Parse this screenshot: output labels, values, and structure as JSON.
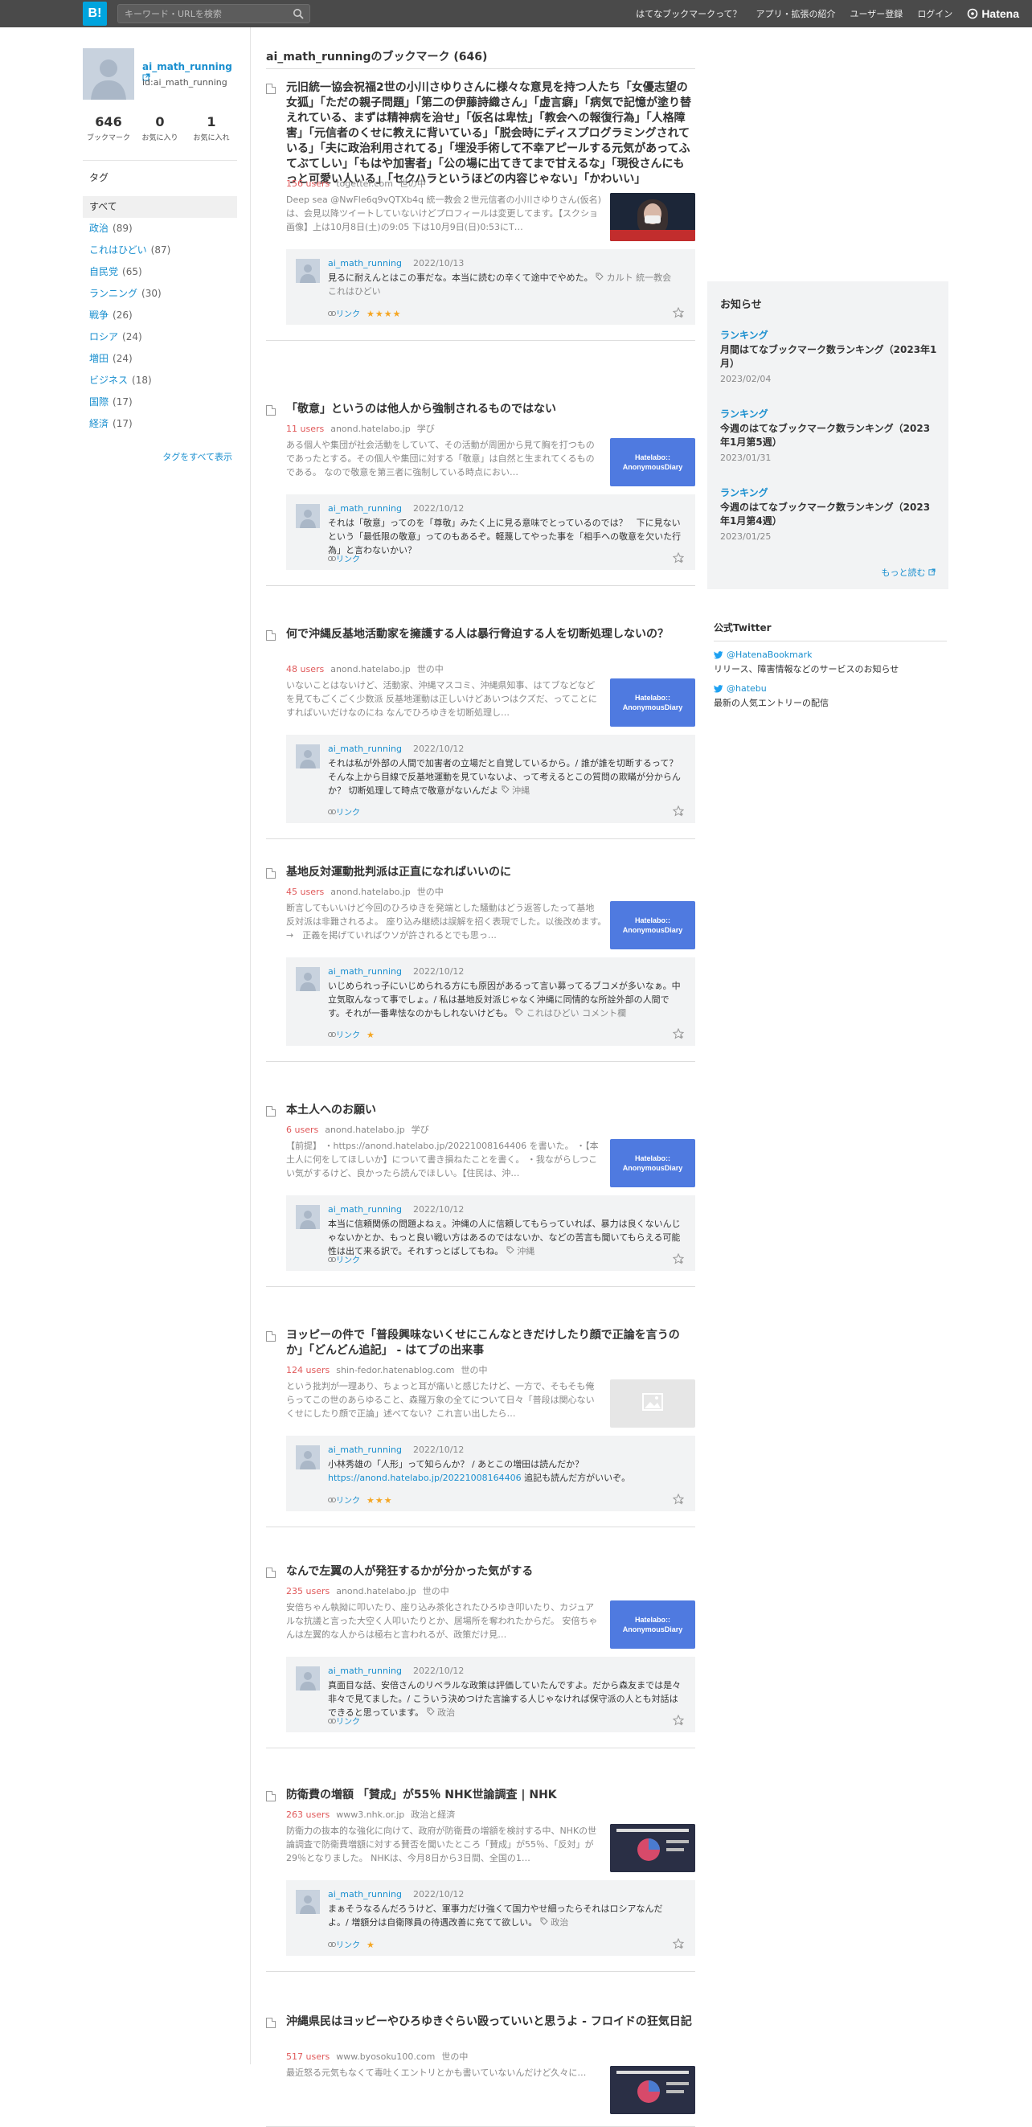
{
  "header": {
    "logo": "B!",
    "search_placeholder": "キーワード・URLを検索",
    "nav": [
      "はてなブックマークって？",
      "アプリ・拡張の紹介",
      "ユーザー登録",
      "ログイン"
    ],
    "brand": "Hatena",
    "bg_color": "#4a4a4a",
    "logo_color": "#00a4de"
  },
  "profile": {
    "name": "ai_math_running",
    "id": "id:ai_math_running",
    "stats": [
      {
        "num": "646",
        "label": "ブックマーク"
      },
      {
        "num": "0",
        "label": "お気に入り"
      },
      {
        "num": "1",
        "label": "お気に入れ"
      }
    ],
    "tag_heading": "タグ",
    "tags": [
      {
        "name": "すべて",
        "count": ""
      },
      {
        "name": "政治",
        "count": "(89)"
      },
      {
        "name": "これはひどい",
        "count": "(87)"
      },
      {
        "name": "自民党",
        "count": "(65)"
      },
      {
        "name": "ランニング",
        "count": "(30)"
      },
      {
        "name": "戦争",
        "count": "(26)"
      },
      {
        "name": "ロシア",
        "count": "(24)"
      },
      {
        "name": "増田",
        "count": "(24)"
      },
      {
        "name": "ビジネス",
        "count": "(18)"
      },
      {
        "name": "国際",
        "count": "(17)"
      },
      {
        "name": "経済",
        "count": "(17)"
      }
    ],
    "all_tags_link": "タグをすべて表示"
  },
  "main": {
    "title": "ai_math_runningのブックマーク (646)",
    "entries": [
      {
        "title": "元旧統一協会祝福2世の小川さゆりさんに様々な意見を持つ人たち「女優志望の女狐」「ただの親子問題」「第二の伊藤詩織さん」「虚言癖」「病気で記憶が塗り替えれている、まずは精神病を治せ」「仮名は卑怯」「教会への報復行為」「人格障害」「元信者のくせに教えに背いている」「脱会時にディスプログラミングされている」「夫に政治利用されてる」「埋没手術して不幸アピールする元気があってふてぶてしい」「もはや加害者」「公の場に出てきてまで甘えるな」「現役さんにもっと可愛い人いる」「セクハラというほどの内容じゃない」「かわいい」",
        "users": "156 users",
        "domain": "togetter.com",
        "category": "世の中",
        "desc": "Deep sea @NwFle6q9vQTXb4q 統一教会２世元信者の小川さゆりさん(仮名)は、会見以降ツイートしていないけどプロフィールは変更してます。【スクショ画像】上は10月8日(土)の9:05 下は10月9日(日)0:53にT…",
        "user": "ai_math_running",
        "date": "2022/10/13",
        "comment": "見るに耐えんとはこの事だな。本当に読むの辛くて途中でやめた。",
        "tags": "カルト 統一教会 これはひどい",
        "link": "リンク",
        "stars": "★★★★"
      },
      {
        "title": "「敬意」というのは他人から強制されるものではない",
        "users": "11 users",
        "domain": "anond.hatelabo.jp",
        "category": "学び",
        "desc": "ある個人や集団が社会活動をしていて、その活動が周囲から見て胸を打つものであったとする。その個人や集団に対する「敬意」は自然と生まれてくるものである。 なので敬意を第三者に強制している時点におい…",
        "user": "ai_math_running",
        "date": "2022/10/12",
        "comment": "それは「敬意」ってのを「尊敬」みたく上に見る意味でとっているのでは？　下に見ないという「最低限の敬意」ってのもあるぞ。軽蔑してやった事を「相手への敬意を欠いた行為」と言わないかい？",
        "tags": "",
        "link": "リンク",
        "stars": ""
      },
      {
        "title": "何で沖縄反基地活動家を擁護する人は暴行脅迫する人を切断処理しないの？",
        "users": "48 users",
        "domain": "anond.hatelabo.jp",
        "category": "世の中",
        "desc": "いないことはないけど、活動家、沖縄マスコミ、沖縄県知事、はてブなどなどを見てもごくごく少数派 反基地運動は正しいけどあいつはクズだ、ってことにすればいいだけなのにね なんでひろゆきを切断処理し…",
        "user": "ai_math_running",
        "date": "2022/10/12",
        "comment": "それは私が外部の人間で加害者の立場だと自覚しているから。/ 誰が誰を切断するって？ そんな上から目線で反基地運動を見ていないよ、って考えるとこの質問の欺瞞が分からんか？ 切断処理して時点で敬意がないんだよ",
        "tags": "沖縄",
        "link": "リンク",
        "stars": ""
      },
      {
        "title": "基地反対運動批判派は正直になればいいのに",
        "users": "45 users",
        "domain": "anond.hatelabo.jp",
        "category": "世の中",
        "desc": "断言してもいいけど今回のひろゆきを発端とした騒動はどう返答したって基地反対派は非難されるよ。 座り込み継続は誤解を招く表現でした。以後改めます。　→　正義を掲げていればウソが許されるとでも思っ…",
        "user": "ai_math_running",
        "date": "2022/10/12",
        "comment": "いじめられっ子にいじめられる方にも原因があるって言い募ってるブコメが多いなぁ。中立気取んなって事でしょ。/ 私は基地反対派じゃなく沖縄に同情的な所詮外部の人間です。それが一番卑怯なのかもしれないけども。",
        "tags": "これはひどい コメント欄",
        "link": "リンク",
        "stars": "★"
      },
      {
        "title": "本土人へのお願い",
        "users": "6 users",
        "domain": "anond.hatelabo.jp",
        "category": "学び",
        "desc": "【前提】 ・https://anond.hatelabo.jp/20221008164406 を書いた。 ・【本土人に何をしてほしいか】について書き損ねたことを書く。 ・我ながらしつこい気がするけど、良かったら読んでほしい。【住民は、沖…",
        "user": "ai_math_running",
        "date": "2022/10/12",
        "comment": "本当に信頼関係の問題よねぇ。沖縄の人に信頼してもらっていれば、暴力は良くないんじゃないかとか、もっと良い戦い方はあるのではないか、などの苦言も聞いてもらえる可能性は出て来る訳で。それすっとばしてもね。",
        "tags": "沖縄",
        "link": "リンク",
        "stars": ""
      },
      {
        "title": "ヨッピーの件で「普段興味ないくせにこんなときだけしたり顔で正論を言うのか」「どんどん追記」 - はてブの出来事",
        "users": "124 users",
        "domain": "shin-fedor.hatenablog.com",
        "category": "世の中",
        "desc": "という批判が一理あり、ちょっと耳が痛いと感じたけど、一方で、そもそも俺らってこの世のあらゆること、森羅万象の全てについて日々「普段は関心ないくせにしたり顔で正論」述べてない？これ言い出したら…",
        "user": "ai_math_running",
        "date": "2022/10/12",
        "comment": "小林秀雄の「人形」って知らんか？ / あとこの増田は読んだか？",
        "comment_link": "https://anond.hatelabo.jp/20221008164406",
        "comment_after": " 追記も読んだ方がいいぞ。",
        "tags": "",
        "link": "リンク",
        "stars": "★★★"
      },
      {
        "title": "なんで左翼の人が発狂するかが分かった気がする",
        "users": "235 users",
        "domain": "anond.hatelabo.jp",
        "category": "世の中",
        "desc": "安倍ちゃん執拗に叩いたり、座り込み茶化されたひろゆき叩いたり、カジュアルな抗議と言った大空く人叩いたりとか、居場所を奪われたからだ。 安倍ちゃんは左翼的な人からは極右と言われるが、政策だけ見…",
        "user": "ai_math_running",
        "date": "2022/10/12",
        "comment": "真面目な話、安倍さんのリベラルな政策は評価していたんですよ。だから森友までは是々非々で見てました。/ こういう決めつけた言論する人じゃなければ保守派の人とも対話はできると思っています。",
        "tags": "政治",
        "link": "リンク",
        "stars": ""
      },
      {
        "title": "防衛費の増額 「賛成」が55％ NHK世論調査 | NHK",
        "users": "263 users",
        "domain": "www3.nhk.or.jp",
        "category": "政治と経済",
        "desc": "防衛力の抜本的な強化に向けて、政府が防衛費の増額を検討する中、NHKの世論調査で防衛費増額に対する賛否を聞いたところ「賛成」が55％、「反対」が29％となりました。 NHKは、今月8日から3日間、全国の1…",
        "user": "ai_math_running",
        "date": "2022/10/12",
        "comment": "まぁそうなるんだろうけど、軍事力だけ強くて国力やせ細ったらそれはロシアなんだよ。/ 増額分は自衛隊員の待遇改善に充てて欲しい。",
        "tags": "政治",
        "link": "リンク",
        "stars": "★"
      },
      {
        "title": "沖縄県民はヨッピーやひろゆきぐらい殴っていいと思うよ - フロイドの狂気日記",
        "users": "517 users",
        "domain": "www.byosoku100.com",
        "category": "世の中",
        "desc": "最近怒る元気もなくて毒吐くエントリとかも書いていないんだけど久々に…"
      }
    ]
  },
  "notices": {
    "heading": "お知らせ",
    "items": [
      {
        "cat": "ランキング",
        "title": "月間はてなブックマーク数ランキング（2023年1月）",
        "date": "2023/02/04"
      },
      {
        "cat": "ランキング",
        "title": "今週のはてなブックマーク数ランキング（2023年1月第5週）",
        "date": "2023/01/31"
      },
      {
        "cat": "ランキング",
        "title": "今週のはてなブックマーク数ランキング（2023年1月第4週）",
        "date": "2023/01/25"
      }
    ],
    "more": "もっと読む"
  },
  "twitter": {
    "heading": "公式Twitter",
    "accounts": [
      {
        "handle": "@HatenaBookmark",
        "desc": "リリース、障害情報などのサービスのお知らせ"
      },
      {
        "handle": "@hatebu",
        "desc": "最新の人気エントリーの配信"
      }
    ]
  },
  "icons": {
    "search": "search-icon",
    "star": "add-star-icon",
    "external": "external-link-icon",
    "tag": "tag-icon",
    "link": "link-icon",
    "twitter": "twitter-bird-icon"
  }
}
